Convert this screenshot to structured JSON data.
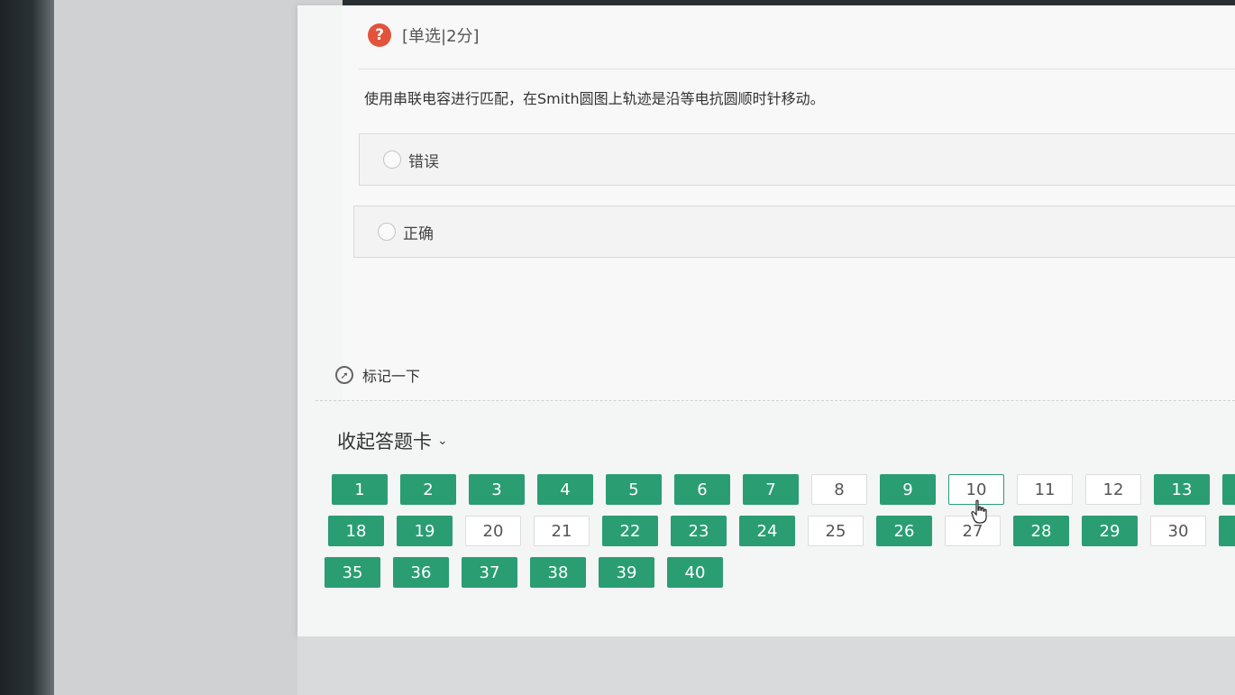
{
  "question": {
    "type_label": "[单选|2分]",
    "text": "使用串联电容进行匹配，在Smith圆图上轨迹是沿等电抗圆顺时针移动。",
    "options": [
      {
        "label": "错误"
      },
      {
        "label": "正确"
      }
    ],
    "mark_label": "标记一下"
  },
  "answer_card": {
    "toggle_label": "收起答题卡",
    "accent_color": "#2a9d73",
    "current": "10",
    "rows": [
      [
        {
          "n": "1",
          "state": "answered"
        },
        {
          "n": "2",
          "state": "answered"
        },
        {
          "n": "3",
          "state": "answered"
        },
        {
          "n": "4",
          "state": "answered"
        },
        {
          "n": "5",
          "state": "answered"
        },
        {
          "n": "6",
          "state": "answered"
        },
        {
          "n": "7",
          "state": "answered"
        },
        {
          "n": "8",
          "state": "unanswered"
        },
        {
          "n": "9",
          "state": "answered"
        },
        {
          "n": "10",
          "state": "current"
        },
        {
          "n": "11",
          "state": "unanswered"
        },
        {
          "n": "12",
          "state": "unanswered"
        },
        {
          "n": "13",
          "state": "answered"
        },
        {
          "n": "",
          "state": "answered"
        }
      ],
      [
        {
          "n": "18",
          "state": "answered"
        },
        {
          "n": "19",
          "state": "answered"
        },
        {
          "n": "20",
          "state": "unanswered"
        },
        {
          "n": "21",
          "state": "unanswered"
        },
        {
          "n": "22",
          "state": "answered"
        },
        {
          "n": "23",
          "state": "answered"
        },
        {
          "n": "24",
          "state": "answered"
        },
        {
          "n": "25",
          "state": "unanswered"
        },
        {
          "n": "26",
          "state": "answered"
        },
        {
          "n": "27",
          "state": "unanswered"
        },
        {
          "n": "28",
          "state": "answered"
        },
        {
          "n": "29",
          "state": "answered"
        },
        {
          "n": "30",
          "state": "unanswered"
        },
        {
          "n": "",
          "state": "answered"
        }
      ],
      [
        {
          "n": "35",
          "state": "answered"
        },
        {
          "n": "36",
          "state": "answered"
        },
        {
          "n": "37",
          "state": "answered"
        },
        {
          "n": "38",
          "state": "answered"
        },
        {
          "n": "39",
          "state": "answered"
        },
        {
          "n": "40",
          "state": "answered"
        }
      ]
    ]
  }
}
